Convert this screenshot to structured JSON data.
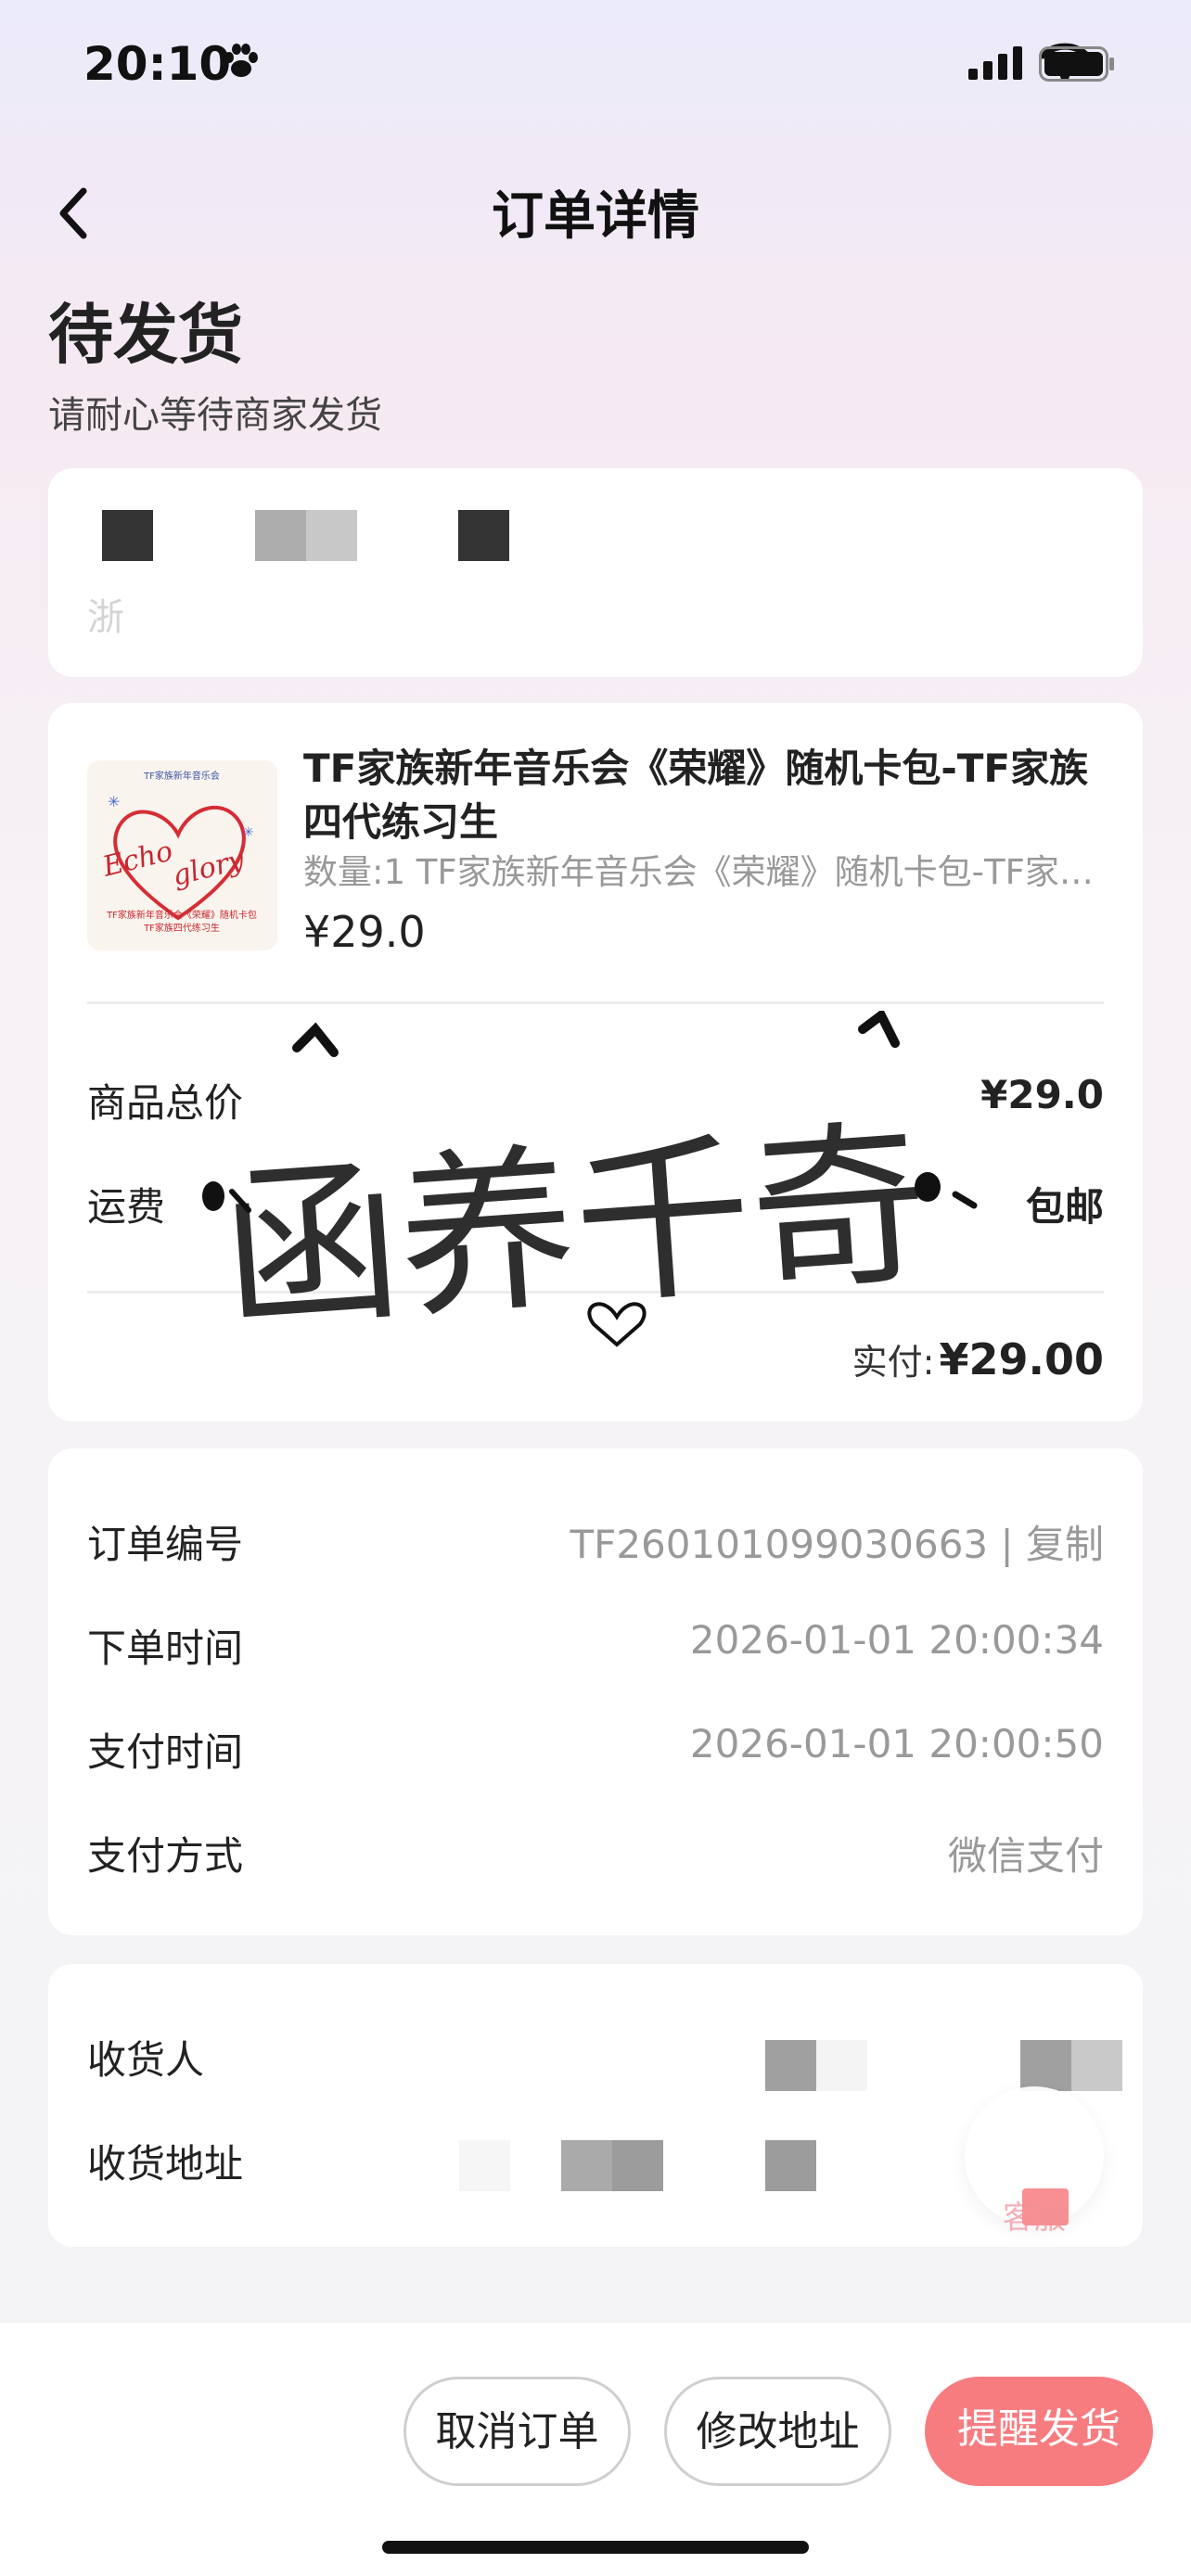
{
  "status_bar": {
    "time": "20:10"
  },
  "nav": {
    "title": "订单详情"
  },
  "order_status": {
    "title": "待发货",
    "subtitle": "请耐心等待商家发货"
  },
  "address_card": {
    "partial_text": "浙"
  },
  "goods": {
    "name": "TF家族新年音乐会《荣耀》随机卡包-TF家族四代练习生",
    "quantity_text": "数量:1 TF家族新年音乐会《荣耀》随机卡包-TF家族四代练习生",
    "price": "¥29.0",
    "thumb_text": {
      "top": "TF家族新年音乐会",
      "script1": "Echo",
      "script2": "glory",
      "caption1": "TF家族新年音乐会《荣耀》随机卡包",
      "caption2": "TF家族四代练习生"
    }
  },
  "price_summary": {
    "total_label": "商品总价",
    "total_value": "¥29.0",
    "shipping_label": "运费",
    "shipping_value": "包邮",
    "paid_label": "实付:",
    "paid_value": "¥29.00"
  },
  "order_info": {
    "rows": [
      {
        "label": "订单编号",
        "value": "TF260101099030663 | 复制"
      },
      {
        "label": "下单时间",
        "value": "2026-01-01 20:00:34"
      },
      {
        "label": "支付时间",
        "value": "2026-01-01 20:00:50"
      },
      {
        "label": "支付方式",
        "value": "微信支付"
      }
    ]
  },
  "receiver": {
    "name_label": "收货人",
    "address_label": "收货地址"
  },
  "watermark_text": "函养千奇",
  "service": {
    "label": "客服"
  },
  "actions": {
    "cancel": "取消订单",
    "modify": "修改地址",
    "remind": "提醒发货"
  }
}
